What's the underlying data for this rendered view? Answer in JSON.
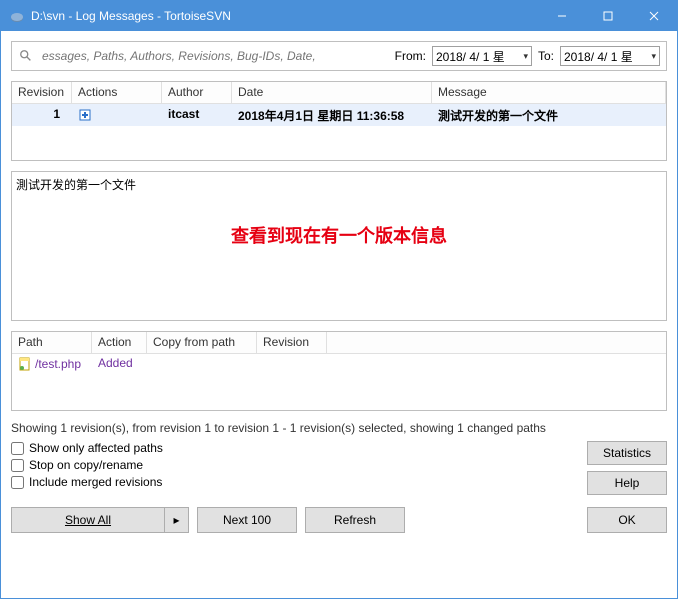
{
  "window": {
    "title": "D:\\svn - Log Messages - TortoiseSVN"
  },
  "filter": {
    "placeholder": "essages, Paths, Authors, Revisions, Bug-IDs, Date,",
    "from_label": "From:",
    "from_date": "2018/ 4/ 1 星",
    "to_label": "To:",
    "to_date": "2018/ 4/ 1 星"
  },
  "log_headers": {
    "revision": "Revision",
    "actions": "Actions",
    "author": "Author",
    "date": "Date",
    "message": "Message"
  },
  "log_rows": [
    {
      "revision": "1",
      "action_icon": "add",
      "author": "itcast",
      "date": "2018年4月1日 星期日 11:36:58",
      "message": "測试开发的第一个文件"
    }
  ],
  "message_text": "測试开发的第一个文件",
  "annotation": "查看到现在有一个版本信息",
  "path_headers": {
    "path": "Path",
    "action": "Action",
    "copy": "Copy from path",
    "revision": "Revision"
  },
  "path_rows": [
    {
      "path": "/test.php",
      "action": "Added",
      "copy": "",
      "revision": ""
    }
  ],
  "status_text": "Showing 1 revision(s), from revision 1 to revision 1 - 1 revision(s) selected, showing 1 changed paths",
  "checkboxes": {
    "affected": "Show only affected paths",
    "stop": "Stop on copy/rename",
    "merged": "Include merged revisions"
  },
  "buttons": {
    "statistics": "Statistics",
    "help": "Help",
    "show_all": "Show All",
    "next100": "Next 100",
    "refresh": "Refresh",
    "ok": "OK"
  }
}
